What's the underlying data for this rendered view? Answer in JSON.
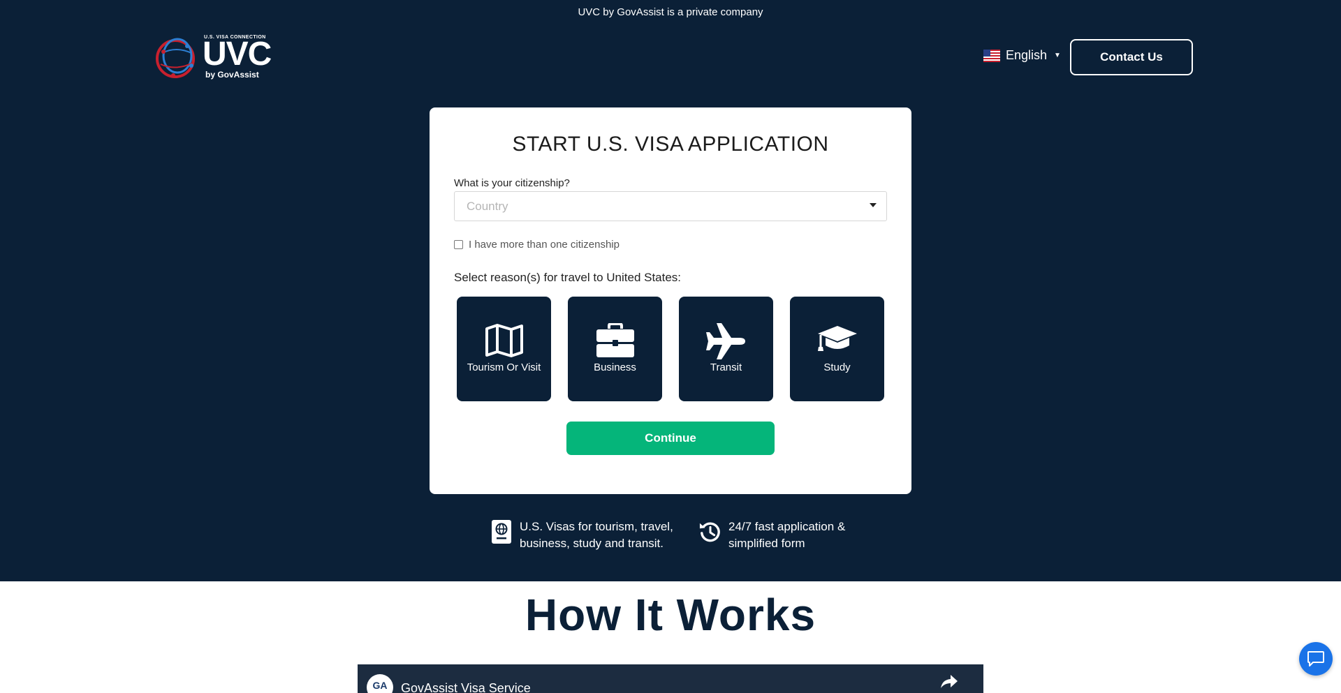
{
  "top_note": "UVC by GovAssist is a private company",
  "logo": {
    "small_text": "U.S. VISA CONNECTION",
    "big_text": "UVC",
    "by_text": "by GovAssist",
    "icon": "globe-logo-icon"
  },
  "header": {
    "language": "English",
    "flag_icon": "us-flag-icon",
    "contact_button": "Contact Us"
  },
  "form": {
    "title": "START U.S. VISA APPLICATION",
    "citizenship_label": "What is your citizenship?",
    "country_placeholder": "Country",
    "multi_citizenship_label": "I have more than one citizenship",
    "multi_citizenship_checked": false,
    "reason_label": "Select reason(s) for travel to United States:",
    "reasons": [
      {
        "label": "Tourism Or Visit",
        "icon": "map-icon"
      },
      {
        "label": "Business",
        "icon": "briefcase-icon"
      },
      {
        "label": "Transit",
        "icon": "plane-icon"
      },
      {
        "label": "Study",
        "icon": "graduation-cap-icon"
      }
    ],
    "continue_button": "Continue"
  },
  "features": [
    {
      "icon": "passport-icon",
      "line1": "U.S. Visas for tourism, travel,",
      "line2": "business, study and transit."
    },
    {
      "icon": "history-icon",
      "line1": "24/7 fast application &",
      "line2": "simplified form"
    }
  ],
  "how_it_works": {
    "title": "How It Works",
    "video_title": "GovAssist Visa Service",
    "video_channel_initials": "GA"
  },
  "colors": {
    "navy": "#0b2037",
    "green": "#05b57a",
    "chat_blue": "#1a73e8"
  }
}
